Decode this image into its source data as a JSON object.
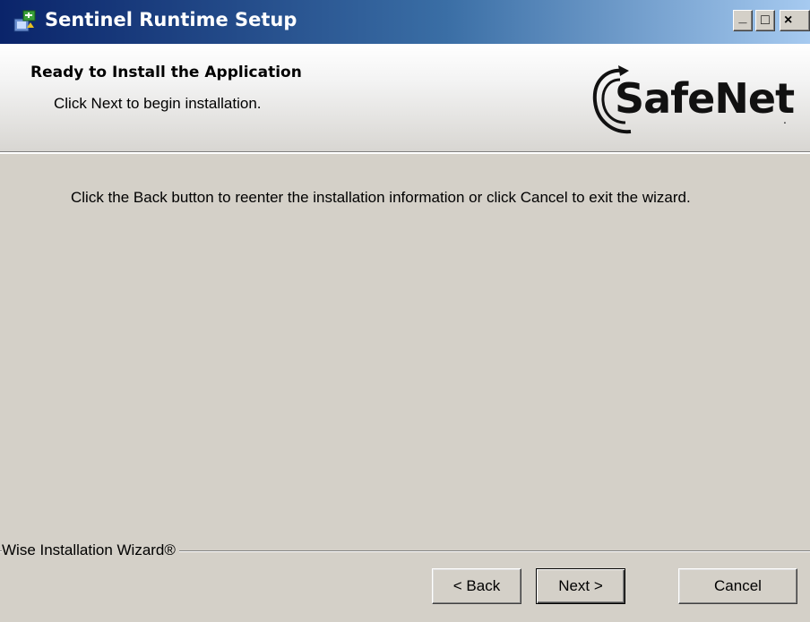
{
  "window": {
    "title": "Sentinel Runtime Setup",
    "controls": {
      "minimize": "_",
      "maximize": "□",
      "close": "×"
    }
  },
  "header": {
    "title": "Ready to Install the Application",
    "subtitle": "Click Next to begin installation.",
    "logo_text": "SafeNet"
  },
  "body": {
    "message": "Click the Back button to reenter the installation information or click Cancel to exit the wizard."
  },
  "footer": {
    "brand_label": "Wise Installation Wizard®",
    "back_label": "< Back",
    "next_label": "Next >",
    "cancel_label": "Cancel"
  },
  "icons": {
    "app": "installer-icon",
    "logo": "safenet-logo"
  },
  "colors": {
    "titlebar_start": "#0a246a",
    "titlebar_end": "#a6caf0",
    "face": "#d4d0c8"
  }
}
